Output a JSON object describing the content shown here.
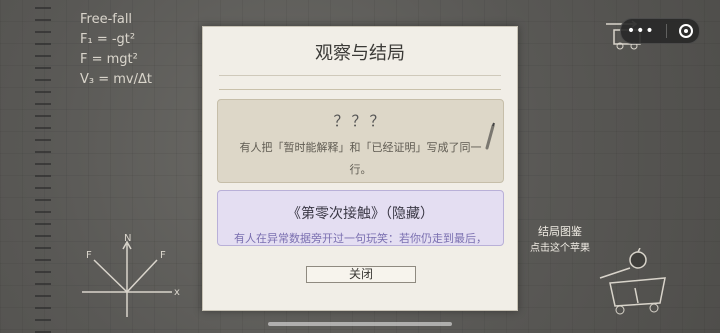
{
  "physics_notes": [
    "Free-fall",
    "F₁ = -gt²",
    "F = mgt²",
    "V₃ = mv/Δt"
  ],
  "capsule": {
    "more_label": "•••"
  },
  "gallery": {
    "title": "结局图鉴",
    "hint": "点击这个苹果"
  },
  "modal": {
    "title": "观察与结局",
    "endings": [
      {
        "title": "？？？",
        "desc": "有人把「暂时能解释」和「已经证明」写成了同一行。"
      },
      {
        "title": "《第零次接触》（隐藏）",
        "desc": "有人在异常数据旁开过一句玩笑：若你仍走到最后，"
      }
    ],
    "close_label": "关闭"
  },
  "colors": {
    "background": "#5a5956",
    "modal": "#f1eee7",
    "hidden_card": "#e4def2",
    "locked_card": "#ddd7c8"
  }
}
